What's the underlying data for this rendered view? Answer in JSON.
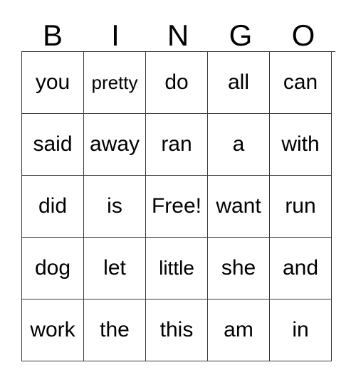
{
  "card": {
    "title": "BINGO",
    "headers": [
      "B",
      "I",
      "N",
      "G",
      "O"
    ],
    "free_space_label": "Free!",
    "colors": {
      "grid_line": "#3a3a3a",
      "text": "#000000",
      "background": "#ffffff"
    },
    "rows": [
      [
        {
          "text": "you",
          "size": "normal"
        },
        {
          "text": "pretty",
          "size": "small"
        },
        {
          "text": "do",
          "size": "normal"
        },
        {
          "text": "all",
          "size": "normal"
        },
        {
          "text": "can",
          "size": "normal"
        }
      ],
      [
        {
          "text": "said",
          "size": "normal"
        },
        {
          "text": "away",
          "size": "normal"
        },
        {
          "text": "ran",
          "size": "normal"
        },
        {
          "text": "a",
          "size": "normal"
        },
        {
          "text": "with",
          "size": "normal"
        }
      ],
      [
        {
          "text": "did",
          "size": "normal"
        },
        {
          "text": "is",
          "size": "normal"
        },
        {
          "text": "Free!",
          "size": "normal"
        },
        {
          "text": "want",
          "size": "normal"
        },
        {
          "text": "run",
          "size": "normal"
        }
      ],
      [
        {
          "text": "dog",
          "size": "normal"
        },
        {
          "text": "let",
          "size": "normal"
        },
        {
          "text": "little",
          "size": "medium"
        },
        {
          "text": "she",
          "size": "normal"
        },
        {
          "text": "and",
          "size": "normal"
        }
      ],
      [
        {
          "text": "work",
          "size": "normal"
        },
        {
          "text": "the",
          "size": "normal"
        },
        {
          "text": "this",
          "size": "normal"
        },
        {
          "text": "am",
          "size": "normal"
        },
        {
          "text": "in",
          "size": "normal"
        }
      ]
    ]
  }
}
